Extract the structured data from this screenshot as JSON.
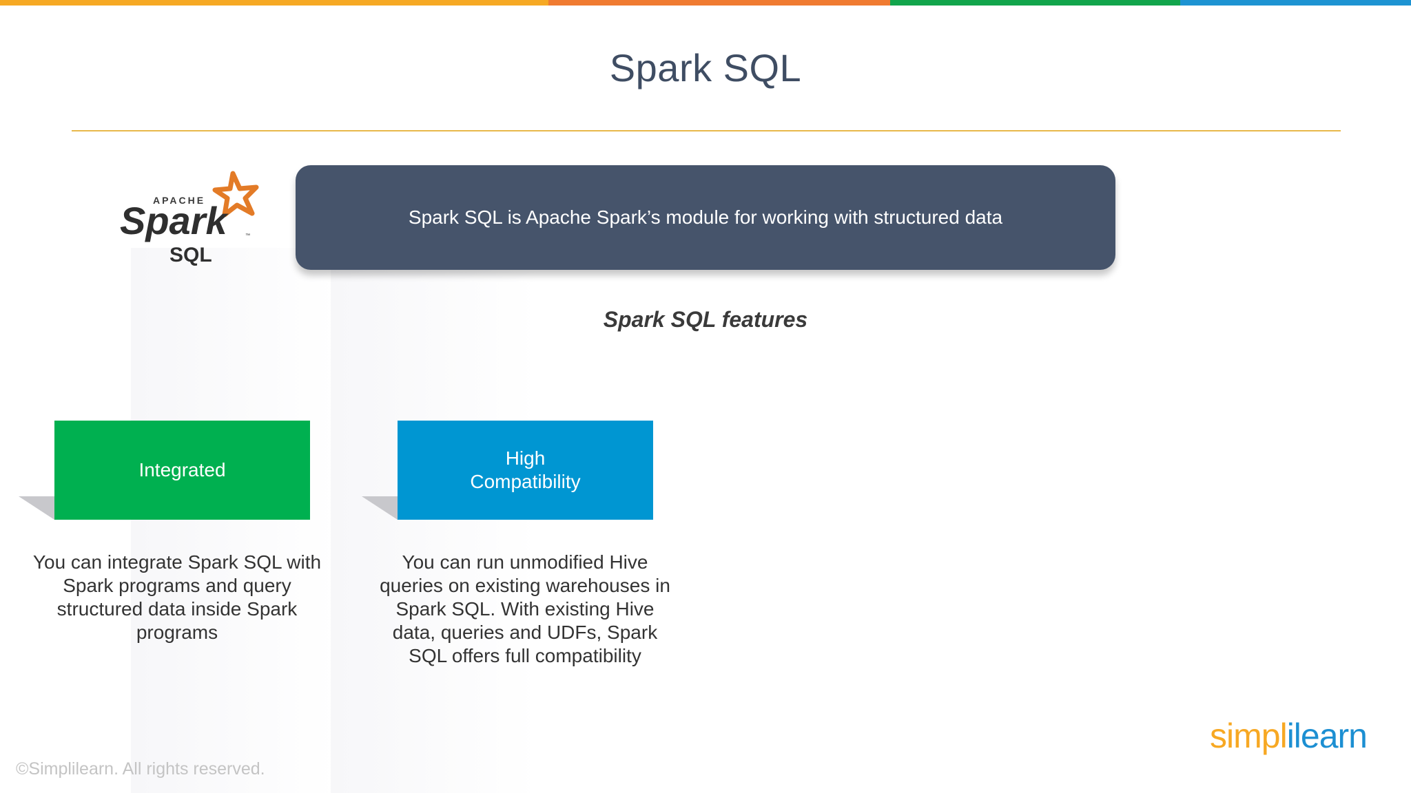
{
  "slide": {
    "title": "Spark SQL",
    "banner_text": "Spark SQL is Apache Spark’s module for working with structured data",
    "features_heading": "Spark SQL features"
  },
  "logo": {
    "apache_word": "APACHE",
    "spark_word": "Spark",
    "sql_word": "SQL",
    "tm": "™",
    "icon": "spark-star-icon"
  },
  "features": [
    {
      "label": "Integrated",
      "color": "#00b050",
      "description": "You can integrate Spark SQL with Spark programs and query structured data inside Spark programs"
    },
    {
      "label": "High\nCompatibility",
      "color": "#0096d2",
      "description": "You can run unmodified Hive queries on existing warehouses in Spark SQL. With existing Hive data, queries and UDFs, Spark SQL offers full compatibility"
    }
  ],
  "footer": {
    "copyright": "©Simplilearn. All rights reserved.",
    "brand_part1": "simpl",
    "brand_part2": "ilearn"
  },
  "colors": {
    "strip": [
      "#f6a924",
      "#f07b31",
      "#12a54c",
      "#1d93d2"
    ],
    "banner": "#46546b",
    "title": "#3f4d63",
    "rule": "#e8b84a"
  }
}
